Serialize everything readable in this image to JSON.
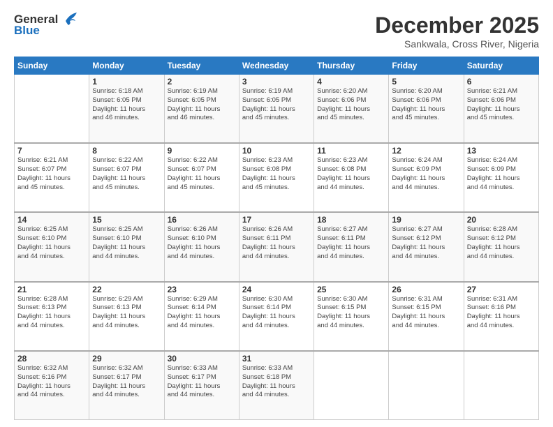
{
  "logo": {
    "line1": "General",
    "line2": "Blue"
  },
  "title": "December 2025",
  "subtitle": "Sankwala, Cross River, Nigeria",
  "days_of_week": [
    "Sunday",
    "Monday",
    "Tuesday",
    "Wednesday",
    "Thursday",
    "Friday",
    "Saturday"
  ],
  "weeks": [
    [
      {
        "day": "",
        "info": ""
      },
      {
        "day": "1",
        "info": "Sunrise: 6:18 AM\nSunset: 6:05 PM\nDaylight: 11 hours\nand 46 minutes."
      },
      {
        "day": "2",
        "info": "Sunrise: 6:19 AM\nSunset: 6:05 PM\nDaylight: 11 hours\nand 46 minutes."
      },
      {
        "day": "3",
        "info": "Sunrise: 6:19 AM\nSunset: 6:05 PM\nDaylight: 11 hours\nand 45 minutes."
      },
      {
        "day": "4",
        "info": "Sunrise: 6:20 AM\nSunset: 6:06 PM\nDaylight: 11 hours\nand 45 minutes."
      },
      {
        "day": "5",
        "info": "Sunrise: 6:20 AM\nSunset: 6:06 PM\nDaylight: 11 hours\nand 45 minutes."
      },
      {
        "day": "6",
        "info": "Sunrise: 6:21 AM\nSunset: 6:06 PM\nDaylight: 11 hours\nand 45 minutes."
      }
    ],
    [
      {
        "day": "7",
        "info": "Sunrise: 6:21 AM\nSunset: 6:07 PM\nDaylight: 11 hours\nand 45 minutes."
      },
      {
        "day": "8",
        "info": "Sunrise: 6:22 AM\nSunset: 6:07 PM\nDaylight: 11 hours\nand 45 minutes."
      },
      {
        "day": "9",
        "info": "Sunrise: 6:22 AM\nSunset: 6:07 PM\nDaylight: 11 hours\nand 45 minutes."
      },
      {
        "day": "10",
        "info": "Sunrise: 6:23 AM\nSunset: 6:08 PM\nDaylight: 11 hours\nand 45 minutes."
      },
      {
        "day": "11",
        "info": "Sunrise: 6:23 AM\nSunset: 6:08 PM\nDaylight: 11 hours\nand 44 minutes."
      },
      {
        "day": "12",
        "info": "Sunrise: 6:24 AM\nSunset: 6:09 PM\nDaylight: 11 hours\nand 44 minutes."
      },
      {
        "day": "13",
        "info": "Sunrise: 6:24 AM\nSunset: 6:09 PM\nDaylight: 11 hours\nand 44 minutes."
      }
    ],
    [
      {
        "day": "14",
        "info": "Sunrise: 6:25 AM\nSunset: 6:10 PM\nDaylight: 11 hours\nand 44 minutes."
      },
      {
        "day": "15",
        "info": "Sunrise: 6:25 AM\nSunset: 6:10 PM\nDaylight: 11 hours\nand 44 minutes."
      },
      {
        "day": "16",
        "info": "Sunrise: 6:26 AM\nSunset: 6:10 PM\nDaylight: 11 hours\nand 44 minutes."
      },
      {
        "day": "17",
        "info": "Sunrise: 6:26 AM\nSunset: 6:11 PM\nDaylight: 11 hours\nand 44 minutes."
      },
      {
        "day": "18",
        "info": "Sunrise: 6:27 AM\nSunset: 6:11 PM\nDaylight: 11 hours\nand 44 minutes."
      },
      {
        "day": "19",
        "info": "Sunrise: 6:27 AM\nSunset: 6:12 PM\nDaylight: 11 hours\nand 44 minutes."
      },
      {
        "day": "20",
        "info": "Sunrise: 6:28 AM\nSunset: 6:12 PM\nDaylight: 11 hours\nand 44 minutes."
      }
    ],
    [
      {
        "day": "21",
        "info": "Sunrise: 6:28 AM\nSunset: 6:13 PM\nDaylight: 11 hours\nand 44 minutes."
      },
      {
        "day": "22",
        "info": "Sunrise: 6:29 AM\nSunset: 6:13 PM\nDaylight: 11 hours\nand 44 minutes."
      },
      {
        "day": "23",
        "info": "Sunrise: 6:29 AM\nSunset: 6:14 PM\nDaylight: 11 hours\nand 44 minutes."
      },
      {
        "day": "24",
        "info": "Sunrise: 6:30 AM\nSunset: 6:14 PM\nDaylight: 11 hours\nand 44 minutes."
      },
      {
        "day": "25",
        "info": "Sunrise: 6:30 AM\nSunset: 6:15 PM\nDaylight: 11 hours\nand 44 minutes."
      },
      {
        "day": "26",
        "info": "Sunrise: 6:31 AM\nSunset: 6:15 PM\nDaylight: 11 hours\nand 44 minutes."
      },
      {
        "day": "27",
        "info": "Sunrise: 6:31 AM\nSunset: 6:16 PM\nDaylight: 11 hours\nand 44 minutes."
      }
    ],
    [
      {
        "day": "28",
        "info": "Sunrise: 6:32 AM\nSunset: 6:16 PM\nDaylight: 11 hours\nand 44 minutes."
      },
      {
        "day": "29",
        "info": "Sunrise: 6:32 AM\nSunset: 6:17 PM\nDaylight: 11 hours\nand 44 minutes."
      },
      {
        "day": "30",
        "info": "Sunrise: 6:33 AM\nSunset: 6:17 PM\nDaylight: 11 hours\nand 44 minutes."
      },
      {
        "day": "31",
        "info": "Sunrise: 6:33 AM\nSunset: 6:18 PM\nDaylight: 11 hours\nand 44 minutes."
      },
      {
        "day": "",
        "info": ""
      },
      {
        "day": "",
        "info": ""
      },
      {
        "day": "",
        "info": ""
      }
    ]
  ]
}
